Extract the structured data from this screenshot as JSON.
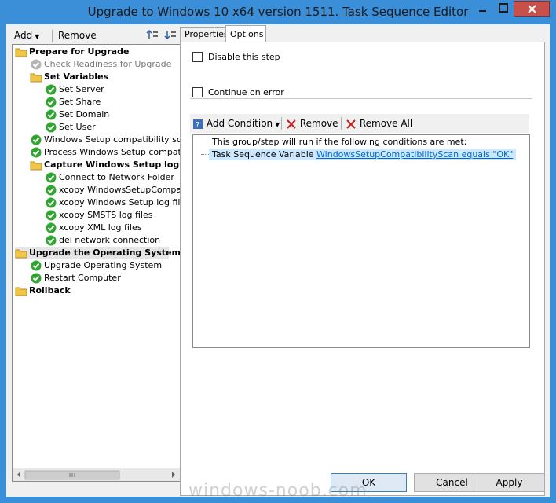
{
  "window": {
    "title": "Upgrade to Windows 10 x64 version 1511. Task Sequence Editor"
  },
  "left_toolbar": {
    "add_label": "Add",
    "remove_label": "Remove"
  },
  "tree": {
    "items": [
      {
        "label": "Prepare for Upgrade",
        "style": "folder-bold"
      },
      {
        "label": "Check Readiness for Upgrade",
        "style": "grey-check"
      },
      {
        "label": "Set Variables",
        "style": "folder-bold"
      },
      {
        "label": "Set Server",
        "style": "check"
      },
      {
        "label": "Set Share",
        "style": "check"
      },
      {
        "label": "Set Domain",
        "style": "check"
      },
      {
        "label": "Set User",
        "style": "check"
      },
      {
        "label": "Windows Setup compatibility scan",
        "style": "check"
      },
      {
        "label": "Process Windows Setup compatibility",
        "style": "check"
      },
      {
        "label": "Capture Windows Setup logs",
        "style": "folder-bold"
      },
      {
        "label": "Connect to Network Folder",
        "style": "check"
      },
      {
        "label": "xcopy WindowsSetupCompatibility",
        "style": "check"
      },
      {
        "label": "xcopy Windows Setup log files",
        "style": "check"
      },
      {
        "label": "xcopy SMSTS log files",
        "style": "check"
      },
      {
        "label": "xcopy XML log files",
        "style": "check"
      },
      {
        "label": "del network connection",
        "style": "check"
      },
      {
        "label": "Upgrade the Operating System",
        "style": "folder-bold"
      },
      {
        "label": "Upgrade Operating System",
        "style": "check"
      },
      {
        "label": "Restart Computer",
        "style": "check"
      },
      {
        "label": "Rollback",
        "style": "folder-bold"
      }
    ]
  },
  "tabs": [
    {
      "label": "Properties"
    },
    {
      "label": "Options"
    }
  ],
  "options": {
    "disable_label": "Disable this step",
    "continue_label": "Continue on error",
    "add_condition": "Add Condition",
    "remove": "Remove",
    "remove_all": "Remove All",
    "cond_header": "This group/step will run if the following conditions are met:",
    "cond_prefix": "Task Sequence Variable",
    "cond_link": "WindowsSetupCompatibilityScan equals \"OK\""
  },
  "buttons": {
    "ok": "OK",
    "cancel": "Cancel",
    "apply": "Apply"
  },
  "watermark": "windows-noob.com",
  "colors": {
    "title_bar": "#3b8fd8",
    "close": "#c7504b",
    "selection": "#cce8ff"
  }
}
